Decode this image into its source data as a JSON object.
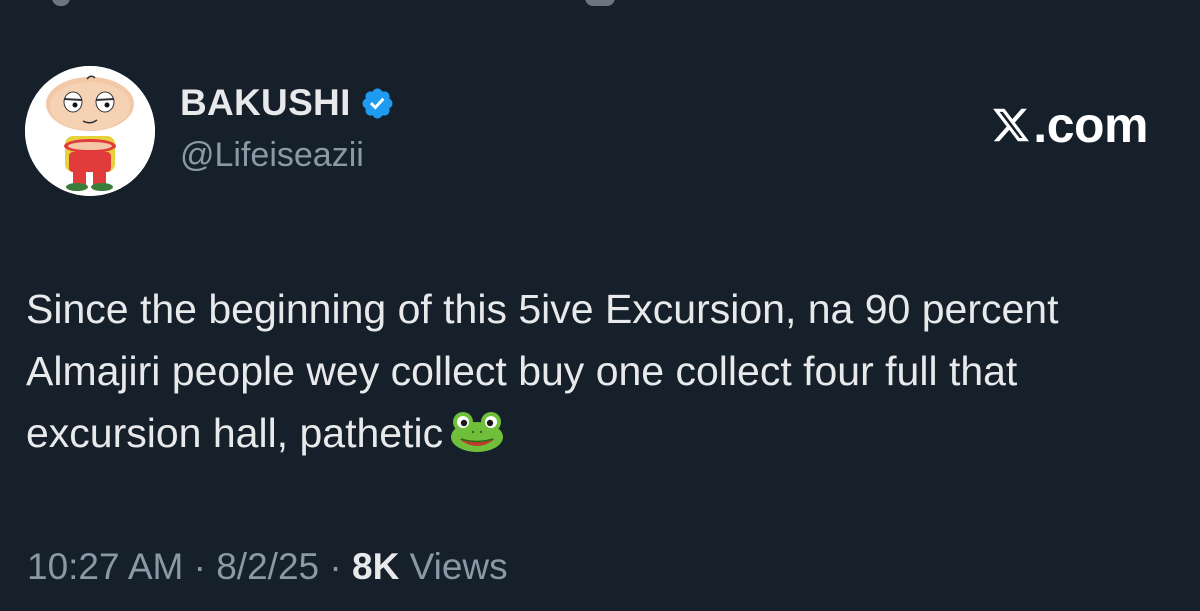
{
  "author": {
    "display_name": "BAKUSHI",
    "handle": "@Lifeiseazii",
    "verified": true,
    "verified_color": "#1d9bf0",
    "avatar_icon": "cartoon-baby-avatar"
  },
  "brand": {
    "label": ".com",
    "logo_icon": "x-logo-icon"
  },
  "tweet": {
    "text": "Since the beginning of this 5ive Excursion, na 90 percent Almajiri people wey collect buy one collect four full that excursion hall, pathetic",
    "emoji_icon": "frog-emoji"
  },
  "meta": {
    "time": "10:27 AM",
    "separator": "·",
    "date": "8/2/25",
    "views_count": "8K",
    "views_label": "Views"
  },
  "colors": {
    "background": "#16202b",
    "text_primary": "#e7e9ea",
    "text_secondary": "#8b98a5",
    "accent": "#1d9bf0"
  }
}
